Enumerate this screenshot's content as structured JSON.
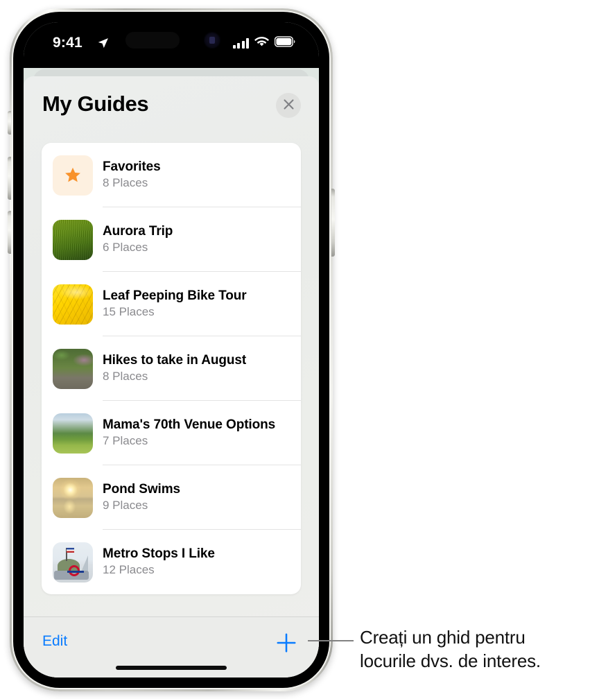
{
  "status_bar": {
    "time": "9:41",
    "location_arrow_icon": "location-arrow-icon",
    "cellular_icon": "cellular-signal-icon",
    "wifi_icon": "wifi-icon",
    "battery_icon": "battery-icon"
  },
  "sheet": {
    "title": "My Guides",
    "close_icon": "close-x-icon"
  },
  "guides": [
    {
      "name": "Favorites",
      "count": "8 Places",
      "thumb": "star-icon"
    },
    {
      "name": "Aurora Trip",
      "count": "6 Places",
      "thumb": "photo-green-field"
    },
    {
      "name": "Leaf Peeping Bike Tour",
      "count": "15 Places",
      "thumb": "photo-yellow-leaves"
    },
    {
      "name": "Hikes to take in August",
      "count": "8 Places",
      "thumb": "photo-forest-trail"
    },
    {
      "name": "Mama's 70th Venue Options",
      "count": "7 Places",
      "thumb": "photo-green-meadow"
    },
    {
      "name": "Pond Swims",
      "count": "9 Places",
      "thumb": "photo-sunset-pond"
    },
    {
      "name": "Metro Stops I Like",
      "count": "12 Places",
      "thumb": "photo-monument-metro"
    }
  ],
  "toolbar": {
    "edit_label": "Edit",
    "add_icon": "plus-icon",
    "accent_color": "#0a7cff"
  },
  "callout": {
    "text": "Creați un ghid pentru locurile dvs. de interes."
  }
}
